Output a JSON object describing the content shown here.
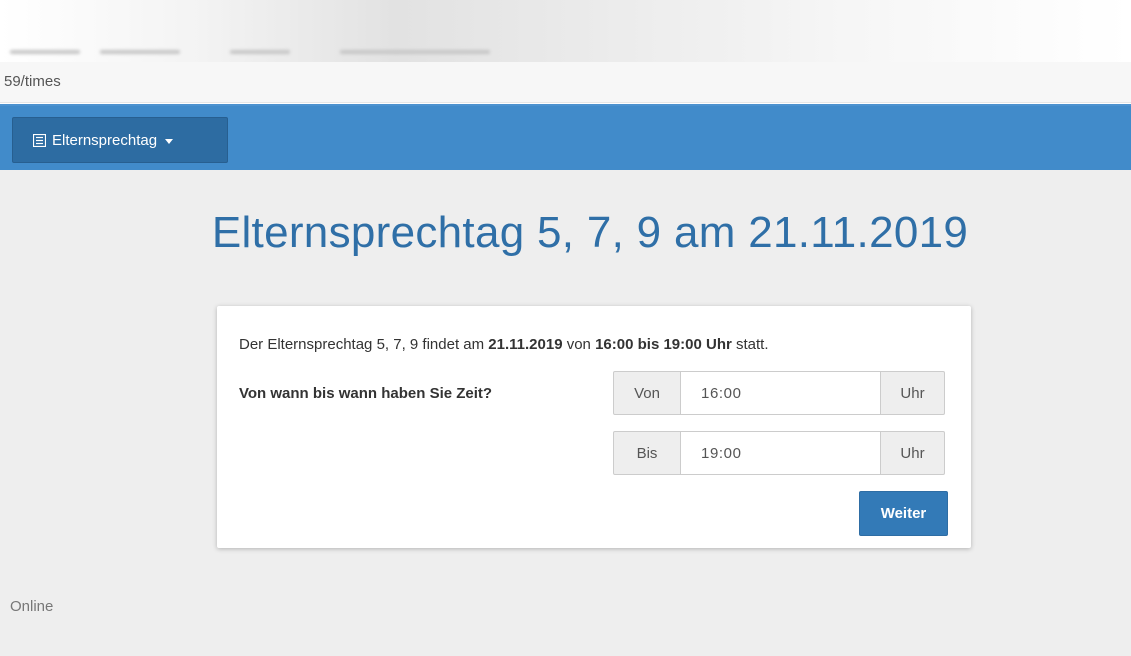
{
  "browser": {
    "url_fragment": "59/times"
  },
  "navbar": {
    "menu_label": "Elternsprechtag",
    "menu_icon": "list-icon",
    "accent_color": "#418bca",
    "button_color": "#2d6ca2"
  },
  "main": {
    "title": "Elternsprechtag 5, 7, 9 am 21.11.2019",
    "description": {
      "prefix": "Der Elternsprechtag 5, 7, 9 findet am ",
      "date": "21.11.2019",
      "middle": " von ",
      "time_range": "16:00 bis 19:00 Uhr",
      "suffix": " statt."
    },
    "question": "Von wann bis wann haben Sie Zeit?",
    "from": {
      "label": "Von",
      "value": "16:00",
      "unit": "Uhr"
    },
    "to": {
      "label": "Bis",
      "value": "19:00",
      "unit": "Uhr"
    },
    "submit_label": "Weiter",
    "submit_color": "#337ab7"
  },
  "footer": {
    "text": "Online"
  }
}
